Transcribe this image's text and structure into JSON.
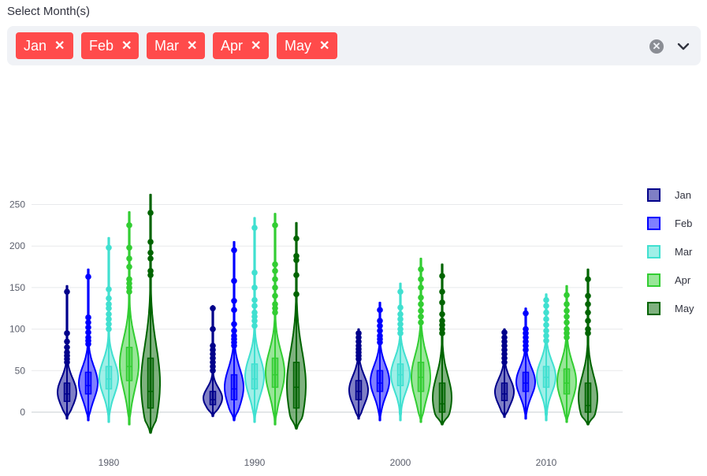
{
  "select_label": "Select Month(s)",
  "chips": [
    {
      "label": "Jan",
      "remove": "✕"
    },
    {
      "label": "Feb",
      "remove": "✕"
    },
    {
      "label": "Mar",
      "remove": "✕"
    },
    {
      "label": "Apr",
      "remove": "✕"
    },
    {
      "label": "May",
      "remove": "✕"
    }
  ],
  "clear_glyph": "✕",
  "colors": {
    "Jan": "#00008b",
    "Feb": "#0000ff",
    "Mar": "#40e0d0",
    "Apr": "#32cd32",
    "May": "#006400",
    "chip": "#ff4b4b"
  },
  "chart_data": {
    "type": "violin",
    "categories": [
      "1980",
      "1990",
      "2000",
      "2010"
    ],
    "ylim": [
      -30,
      270
    ],
    "yticks": [
      0,
      50,
      100,
      150,
      200,
      250
    ],
    "legend_position": "right",
    "grid": true,
    "series": [
      {
        "name": "Jan",
        "groups": [
          {
            "min": -8,
            "q1": 13,
            "median": 22,
            "q3": 35,
            "max": 152,
            "outliers": [
              145,
              95,
              85,
              78,
              72,
              68,
              64,
              60
            ]
          },
          {
            "min": -5,
            "q1": 9,
            "median": 15,
            "q3": 25,
            "max": 128,
            "outliers": [
              125,
              100,
              80,
              75,
              70,
              65,
              60,
              55,
              50
            ]
          },
          {
            "min": -8,
            "q1": 15,
            "median": 25,
            "q3": 38,
            "max": 100,
            "outliers": [
              95,
              90,
              85,
              80,
              76,
              72,
              68,
              64
            ]
          },
          {
            "min": -6,
            "q1": 14,
            "median": 22,
            "q3": 35,
            "max": 100,
            "outliers": [
              96,
              90,
              85,
              80,
              75,
              70,
              65,
              60
            ]
          }
        ]
      },
      {
        "name": "Feb",
        "groups": [
          {
            "min": -10,
            "q1": 22,
            "median": 32,
            "q3": 48,
            "max": 172,
            "outliers": [
              163,
              114,
              108,
              102,
              96,
              90,
              86,
              82
            ]
          },
          {
            "min": -10,
            "q1": 15,
            "median": 28,
            "q3": 45,
            "max": 205,
            "outliers": [
              195,
              158,
              134,
              123,
              106,
              98,
              92,
              88,
              84,
              80
            ]
          },
          {
            "min": -10,
            "q1": 25,
            "median": 35,
            "q3": 50,
            "max": 132,
            "outliers": [
              123,
              110,
              104,
              98,
              92,
              88,
              84
            ]
          },
          {
            "min": -8,
            "q1": 25,
            "median": 35,
            "q3": 48,
            "max": 125,
            "outliers": [
              119,
              100,
              95,
              90,
              85,
              80,
              75
            ]
          }
        ]
      },
      {
        "name": "Mar",
        "groups": [
          {
            "min": -12,
            "q1": 28,
            "median": 40,
            "q3": 55,
            "max": 210,
            "outliers": [
              198,
              148,
              137,
              130,
              125,
              118,
              112,
              106,
              100
            ]
          },
          {
            "min": -12,
            "q1": 28,
            "median": 40,
            "q3": 58,
            "max": 234,
            "outliers": [
              222,
              168,
              150,
              135,
              128,
              120,
              115,
              110,
              104
            ]
          },
          {
            "min": -10,
            "q1": 32,
            "median": 45,
            "q3": 58,
            "max": 155,
            "outliers": [
              145,
              126,
              118,
              112,
              106,
              100,
              95
            ]
          },
          {
            "min": -10,
            "q1": 30,
            "median": 42,
            "q3": 55,
            "max": 142,
            "outliers": [
              135,
              128,
              120,
              112,
              105,
              98,
              92,
              86
            ]
          }
        ]
      },
      {
        "name": "Apr",
        "groups": [
          {
            "min": -15,
            "q1": 38,
            "median": 55,
            "q3": 78,
            "max": 241,
            "outliers": [
              225,
              198,
              185,
              175,
              160,
              155,
              150,
              145
            ]
          },
          {
            "min": -15,
            "q1": 30,
            "median": 45,
            "q3": 65,
            "max": 239,
            "outliers": [
              225,
              178,
              170,
              160,
              150,
              140,
              130,
              125,
              120
            ]
          },
          {
            "min": -12,
            "q1": 25,
            "median": 42,
            "q3": 60,
            "max": 185,
            "outliers": [
              172,
              160,
              150,
              138,
              130,
              122,
              115,
              108
            ]
          },
          {
            "min": -12,
            "q1": 22,
            "median": 35,
            "q3": 52,
            "max": 152,
            "outliers": [
              141,
              130,
              122,
              115,
              108,
              100,
              95,
              90
            ]
          }
        ]
      },
      {
        "name": "May",
        "groups": [
          {
            "min": -25,
            "q1": 5,
            "median": 25,
            "q3": 65,
            "max": 262,
            "outliers": [
              240,
              205,
              192,
              185,
              170,
              165
            ]
          },
          {
            "min": -20,
            "q1": 5,
            "median": 30,
            "q3": 60,
            "max": 228,
            "outliers": [
              209,
              188,
              183,
              165,
              142
            ]
          },
          {
            "min": -15,
            "q1": 0,
            "median": 10,
            "q3": 35,
            "max": 178,
            "outliers": [
              164,
              145,
              132,
              118,
              110,
              105,
              100,
              95
            ]
          },
          {
            "min": -15,
            "q1": 0,
            "median": 8,
            "q3": 35,
            "max": 172,
            "outliers": [
              160,
              140,
              130,
              120,
              110,
              100,
              95
            ]
          }
        ]
      }
    ]
  }
}
